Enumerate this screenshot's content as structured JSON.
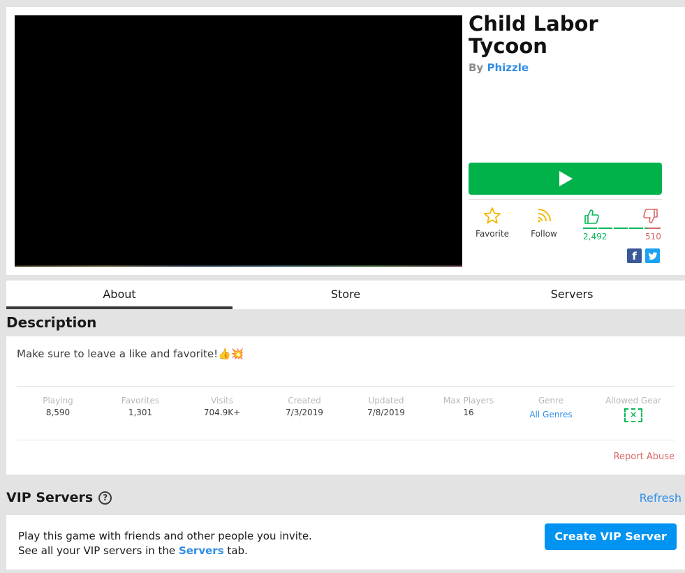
{
  "game": {
    "title": "Child Labor Tycoon",
    "by_label": "By",
    "creator": "Phizzle"
  },
  "actions": {
    "favorite_label": "Favorite",
    "follow_label": "Follow",
    "upvotes": "2,492",
    "downvotes": "510"
  },
  "tabs": [
    {
      "label": "About",
      "active": true
    },
    {
      "label": "Store",
      "active": false
    },
    {
      "label": "Servers",
      "active": false
    }
  ],
  "description": {
    "heading": "Description",
    "text": "Make sure to leave a like and favorite!👍💥"
  },
  "stats": [
    {
      "label": "Playing",
      "value": "8,590"
    },
    {
      "label": "Favorites",
      "value": "1,301"
    },
    {
      "label": "Visits",
      "value": "704.9K+"
    },
    {
      "label": "Created",
      "value": "7/3/2019"
    },
    {
      "label": "Updated",
      "value": "7/8/2019"
    },
    {
      "label": "Max Players",
      "value": "16"
    },
    {
      "label": "Genre",
      "value": "All Genres"
    },
    {
      "label": "Allowed Gear",
      "value": ""
    }
  ],
  "report_abuse": "Report Abuse",
  "vip": {
    "heading": "VIP Servers",
    "refresh": "Refresh",
    "line1": "Play this game with friends and other people you invite.",
    "line2_pre": "See all your VIP servers in the",
    "line2_link": "Servers",
    "line2_post": "tab.",
    "create_button": "Create VIP Server"
  },
  "colors": {
    "play_green": "#01b24a",
    "link_blue": "#2f8ee6",
    "vip_button_blue": "#0193f2",
    "upvote_green": "#02b757",
    "downvote_red": "#d86868"
  }
}
